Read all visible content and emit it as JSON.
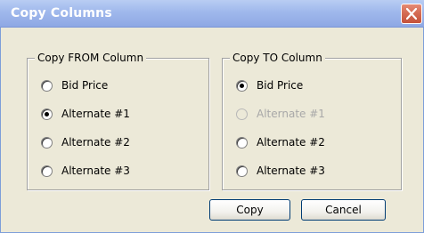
{
  "window": {
    "title": "Copy Columns"
  },
  "from_group": {
    "legend": "Copy FROM Column",
    "options": [
      {
        "label": "Bid Price",
        "checked": false,
        "disabled": false
      },
      {
        "label": "Alternate #1",
        "checked": true,
        "disabled": false
      },
      {
        "label": "Alternate #2",
        "checked": false,
        "disabled": false
      },
      {
        "label": "Alternate #3",
        "checked": false,
        "disabled": false
      }
    ]
  },
  "to_group": {
    "legend": "Copy TO Column",
    "options": [
      {
        "label": "Bid Price",
        "checked": true,
        "disabled": false
      },
      {
        "label": "Alternate #1",
        "checked": false,
        "disabled": true
      },
      {
        "label": "Alternate #2",
        "checked": false,
        "disabled": false
      },
      {
        "label": "Alternate #3",
        "checked": false,
        "disabled": false
      }
    ]
  },
  "buttons": {
    "copy_label": "Copy",
    "cancel_label": "Cancel"
  },
  "icons": {
    "close": "close-icon"
  },
  "colors": {
    "titlebar": "#9fb8ec",
    "title_text": "#ffffff",
    "close_button": "#d36a52",
    "dialog_background": "#ece9d8",
    "disabled_text": "#a8a8a8"
  }
}
